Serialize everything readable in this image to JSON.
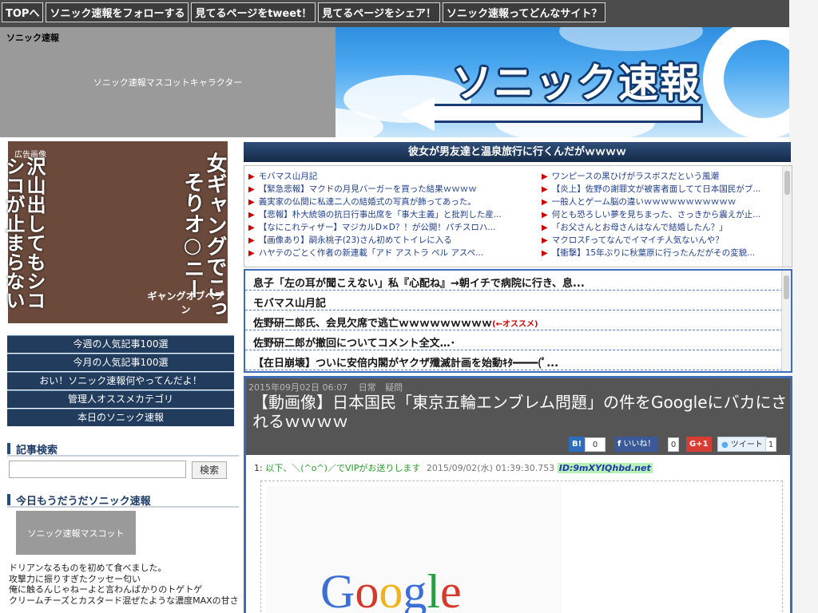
{
  "nav": [
    "TOPへ",
    "ソニック速報をフォローする",
    "見てるページをtweet！",
    "見てるページをシェア！",
    "ソニック速報ってどんなサイト？"
  ],
  "header": {
    "site_small": "ソニック速報",
    "title": "ソニック速報",
    "mascot_label": "ソニック速報マスコットキャラクター"
  },
  "sidebar": {
    "ad_label": "広告画像",
    "ad_text_1": "女ギャングでこっそりオ○ニー",
    "ad_text_2": "沢山出してもシコシコが止まらないw",
    "ad_caption": "ギャングオブヘブン",
    "menu": [
      "今週の人気記事100選",
      "今月の人気記事100選",
      "おい！ソニック速報何やってんだよ！",
      "管理人オススメカテゴリ",
      "本日のソニック速報"
    ],
    "search_title": "記事検索",
    "search_button": "検索",
    "daily_title": "今日もうだうだソニック速報",
    "mascot_label": "ソニック速報マスコット",
    "daily_text": [
      "ドリアンなるものを初めて食べました。",
      "攻撃力に振りすぎたクッセー匂い",
      "俺に触るんじゃねーよと言わんばかりのトゲトゲ",
      "クリームチーズとカスタード混ぜたような濃度MAXの甘さ"
    ]
  },
  "headline": "彼女が男友達と温泉旅行に行くんだがｗｗｗｗ",
  "ring_left": [
    "モバマス山月記",
    "【緊急悲報】マクドの月見バーガーを買った結果ｗｗｗｗ",
    "義実家の仏間に私達二人の結婚式の写真が飾ってあった。",
    "【悲報】朴大統領の抗日行事出席を「事大主義」と批判した産...",
    "【なにこれティザー】マジカルD×D？！が公開！パチスロハ...",
    "【画像あり】嗣永桃子(23)さん初めてトイレに入る",
    "ハヤテのごとく作者の新連載「アド アストラ ペル アスペ..."
  ],
  "ring_right": [
    "ワンピースの黒ひげがラスボスだという風潮",
    "【炎上】佐野の謝罪文が被害者面してて日本国民がブ...",
    "一般人とゲーム脳の違いｗｗｗｗｗｗｗｗｗｗｗ",
    "何とも恐ろしい夢を見ちまった、さっきから震えが止...",
    "「お父さんとお母さんはなんで結婚したん？」",
    "マクロスFってなんでイマイチ人気ないんや？",
    "【衝撃】15年ぶりに秋葉原に行ったんだがその変貌..."
  ],
  "bold_list": [
    {
      "text": "息子「左の耳が聞こえない」私『心配ね』→朝イチで病院に行き、息...",
      "tag": ""
    },
    {
      "text": "モバマス山月記",
      "tag": ""
    },
    {
      "text": "佐野研二郎氏、会見欠席で逃亡ｗｗｗｗｗｗｗｗｗ",
      "tag": "(←オススメ)"
    },
    {
      "text": "佐野研二郎が撤回についてコメント全文…･",
      "tag": ""
    },
    {
      "text": "【在日崩壊】ついに安倍内閣がヤクザ殲滅計画を始動ｷﾀ━━━━(ﾟ...",
      "tag": ""
    }
  ],
  "article": {
    "date": "2015年09月02日 06:07",
    "cat1": "日常",
    "cat2": "疑問",
    "title": "【動画像】日本国民「東京五輪エンブレム問題」の件をGoogleにバカにされるｗｗｗｗ",
    "share": [
      {
        "label": "B!",
        "count": "0",
        "color": "#2c6ebd"
      },
      {
        "label": "いいね！",
        "count": "0",
        "color": "#3b5998"
      },
      {
        "label": "G+1",
        "count": "",
        "color": "#d73d32"
      },
      {
        "label": "ツイート",
        "count": "1",
        "color": "#55acee"
      }
    ],
    "res_num": "1:",
    "res_name": "以下、＼(^o^)／でVIPがお送りします",
    "res_date": "2015/09/02(水) 01:39:30.753",
    "res_id": "ID:9mXYIQhbd.net",
    "image_label": "Google"
  }
}
